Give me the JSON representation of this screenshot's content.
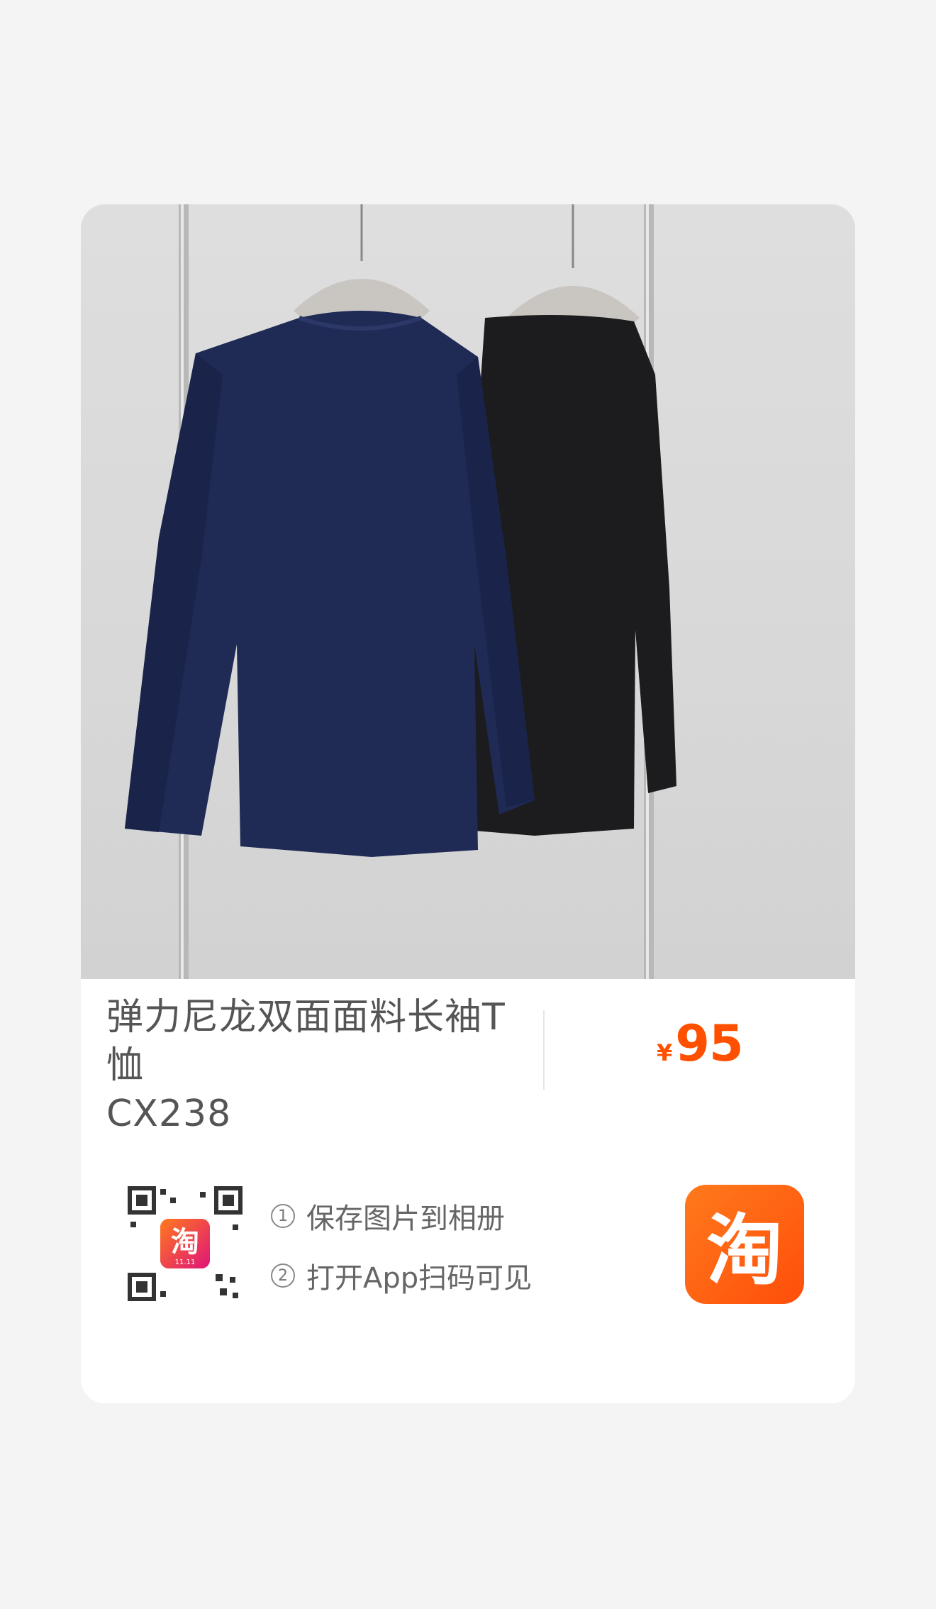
{
  "product": {
    "title_line1": "弹力尼龙双面面料长袖T恤",
    "title_line2": "CX238",
    "price_currency": "¥",
    "price_amount": "95"
  },
  "share": {
    "step1_num": "1",
    "step1_text": "保存图片到相册",
    "step2_num": "2",
    "step2_text": "打开App扫码可见",
    "qr_badge_text": "淘",
    "qr_badge_sub": "11.11",
    "app_logo_text": "淘"
  },
  "colors": {
    "accent": "#ff5000",
    "shirt_navy": "#1f2a55",
    "shirt_black": "#1c1c1e"
  },
  "icons": [
    "qr-code-icon",
    "taobao-app-icon"
  ]
}
